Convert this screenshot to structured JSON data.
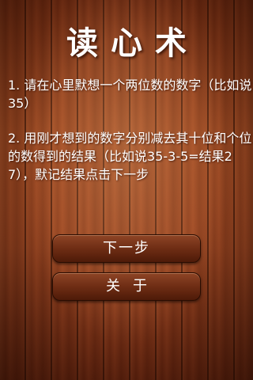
{
  "title": "读心术",
  "instructions": {
    "step1": "1. 请在心里默想一个两位数的数字（比如说35）",
    "step2": "2. 用刚才想到的数字分别减去其十位和个位的数得到的结果（比如说35-3-5=结果27），默记结果点击下一步"
  },
  "buttons": {
    "next_label": "下一步",
    "about_label": "关于"
  }
}
